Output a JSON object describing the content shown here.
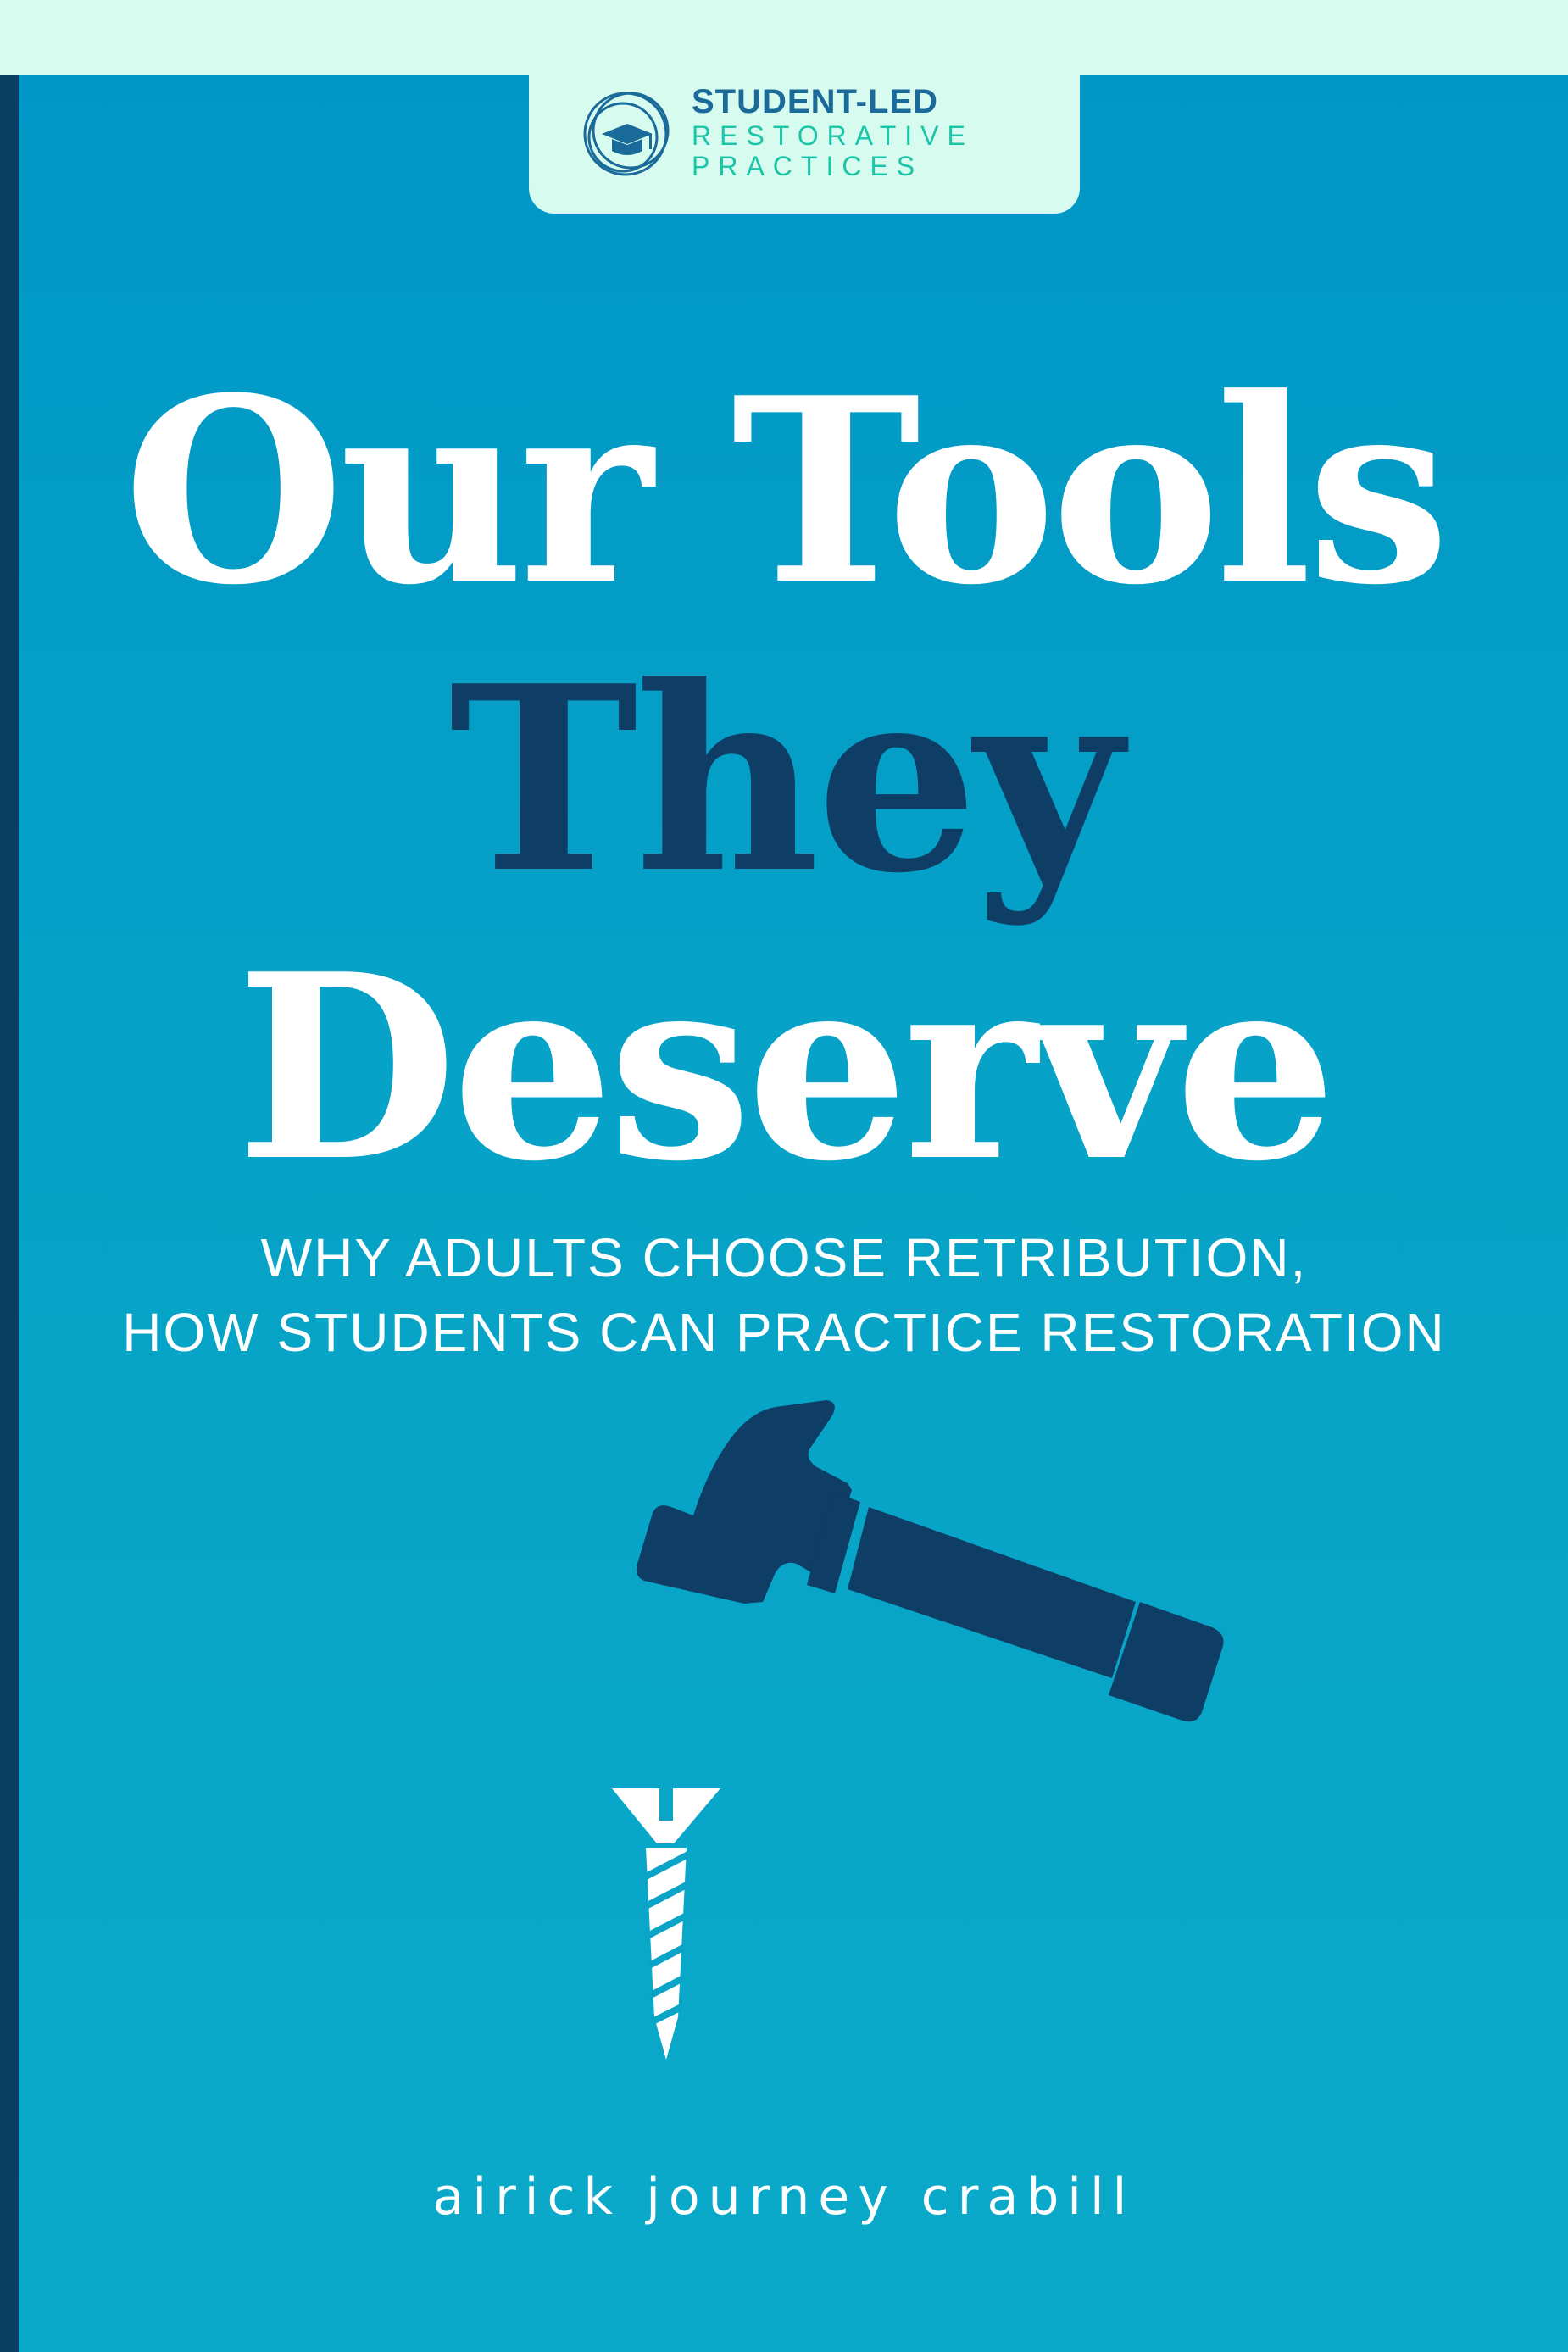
{
  "badge": {
    "line1": "STUDENT-LED",
    "line2": "RESTORATIVE",
    "line3": "PRACTICES"
  },
  "title": {
    "line1": "Our Tools",
    "line2": "They",
    "line3": "Deserve"
  },
  "subtitle": {
    "line1": "WHY ADULTS CHOOSE RETRIBUTION,",
    "line2": "HOW STUDENTS CAN PRACTICE RESTORATION"
  },
  "author": "airick journey crabill",
  "colors": {
    "background": "#03a0c6",
    "band": "#d8fbef",
    "navy": "#0e3d66",
    "spine": "#0a3f64",
    "teal": "#1cc4a8"
  },
  "icons": [
    "logo-circles-icon",
    "graduation-cap-icon",
    "hammer-icon",
    "screw-icon"
  ]
}
